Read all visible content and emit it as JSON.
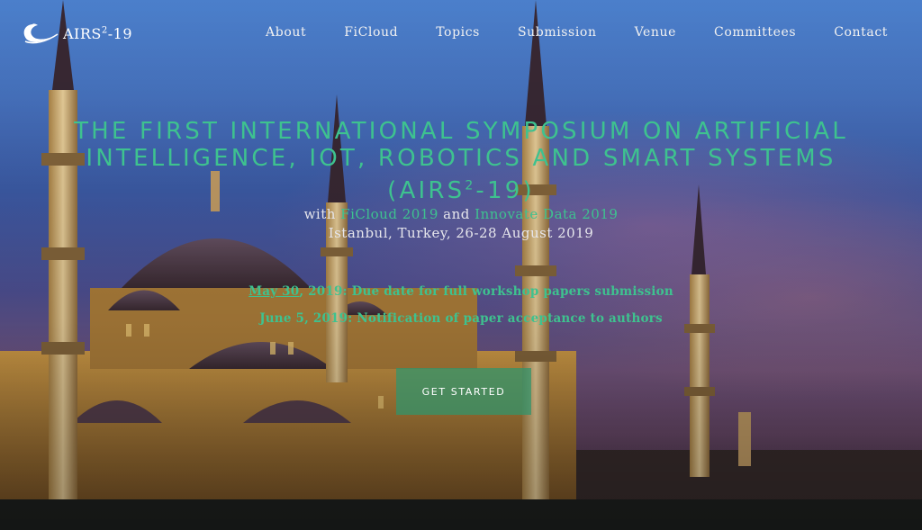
{
  "logo": {
    "text": "AIRS",
    "sup": "2",
    "suffix": "-19",
    "icon": "wave-swirl-icon"
  },
  "nav": {
    "items": [
      {
        "label": "About"
      },
      {
        "label": "FiCloud"
      },
      {
        "label": "Topics"
      },
      {
        "label": "Submission"
      },
      {
        "label": "Venue"
      },
      {
        "label": "Committees"
      },
      {
        "label": "Contact"
      }
    ]
  },
  "hero": {
    "title_line1": "THE FIRST INTERNATIONAL SYMPOSIUM ON ARTIFICIAL",
    "title_line2": "INTELLIGENCE, IOT, ROBOTICS AND SMART SYSTEMS",
    "title_line3_prefix": "(AIRS",
    "title_line3_sup": "2",
    "title_line3_suffix": "-19)",
    "with_prefix": "with",
    "with_link1": "FiCloud 2019",
    "with_and": "and",
    "with_link2": "Innovate Data 2019",
    "location": "Istanbul, Turkey, 26-28 August 2019",
    "date1_link": "May 30",
    "date1_rest": ", 2019: Due date for full workshop papers submission",
    "date2": "June 5, 2019: Notification of paper acceptance to authors",
    "cta_label": "GET STARTED"
  },
  "colors": {
    "accent": "#3ec28f",
    "button": "#2e966e"
  }
}
